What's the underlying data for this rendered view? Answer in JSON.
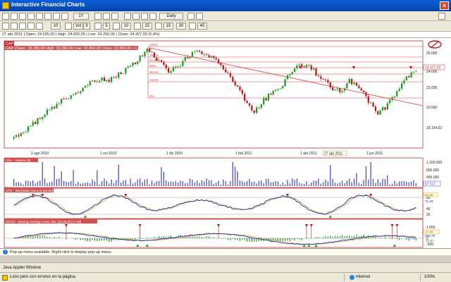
{
  "window": {
    "title": "Interactive Financial Charts"
  },
  "toolbar1": {
    "items": [
      "1Y",
      "Daily",
      "45"
    ],
    "period_label": "1Y",
    "interval_label": "Daily"
  },
  "toolbar2": {
    "items": [
      "10",
      "Vol",
      "9",
      "5",
      "10",
      "15",
      "15",
      "30",
      "45"
    ]
  },
  "infobar": {
    "text": "27 abr 2011 | Open: 24.535,00 | High: 24.600,00 | Low: 24.250,00 | Close: 24.427,00 (0,4%)"
  },
  "price_panel": {
    "ticker_badge": "CAP",
    "header": "CAP (Open: 23.280,00   High: 23.280,00   Low: 22.850,00   Close: 22.900,00   (-1,6%))",
    "y_ticks": [
      "26.000",
      "24.000",
      "22.000",
      "20.000"
    ],
    "last_price_label": "24.427,00",
    "low_label": "18.154,62",
    "fib_levels": [
      "100%",
      "76,4%",
      "61,8%",
      "50%",
      "38,2%",
      "23,6%",
      "0%"
    ],
    "x_labels": [
      "2 ago 2010",
      "1 oct 2010",
      "1 dic 2010",
      "1 feb 2011",
      "1 abr 2011",
      "27 abr 2011",
      "1 jun 2011"
    ]
  },
  "volume_panel": {
    "header": "VOL - Volume (0)",
    "y_ticks": [
      "1.200.000",
      "800.000",
      "400.000"
    ],
    "last_label": "57.517"
  },
  "stoch_panel": {
    "header": "STO - Stochastic (15,3,3) [82,80]",
    "y_ticks": [
      "80",
      "40",
      "20"
    ],
    "label_a": "82,80",
    "label_b": "71,19"
  },
  "macd_panel": {
    "header": "MACD - Moving Average Conv. Div. (12,26,9) [17,88]",
    "y_ticks": [
      "1.000",
      "500",
      "0",
      "-500"
    ],
    "label_a": "17,88",
    "label_b": "466,79",
    "label_c": "-12,57"
  },
  "popup_bar": {
    "text": "Pop-up menu available. Right-click to display pop-up menu."
  },
  "applet_bar": {
    "text": "Java Applet Window"
  },
  "statusbar": {
    "message": "Listo pero con errores en la página.",
    "zone": "Internet",
    "zoom": "100%"
  },
  "colors": {
    "up_candle": "#1a9a1a",
    "down_candle": "#c01010",
    "fib_line": "#d04040",
    "stoch_k": "#1a2a9a",
    "stoch_d": "#d8a040",
    "macd_line": "#1a2a9a",
    "volume_bar": "#4040c0",
    "panel_border": "#c03030"
  },
  "chart_data": {
    "type": "line",
    "title": "",
    "series": [
      {
        "name": "CAP",
        "values": [
          18200,
          18700,
          19500,
          20300,
          21000,
          21700,
          22100,
          22600,
          23300,
          23700,
          23600,
          24200,
          24800,
          25500,
          26400,
          25500,
          24500,
          24700,
          25700,
          26300,
          25900,
          25500,
          24600,
          23400,
          22000,
          20500,
          21600,
          22600,
          23000,
          24500,
          25000,
          24800,
          23800,
          23000,
          22500,
          23500,
          23000,
          21700,
          20300,
          21300,
          22500,
          23800,
          24427
        ]
      }
    ],
    "ylim": [
      17500,
      27000
    ]
  }
}
